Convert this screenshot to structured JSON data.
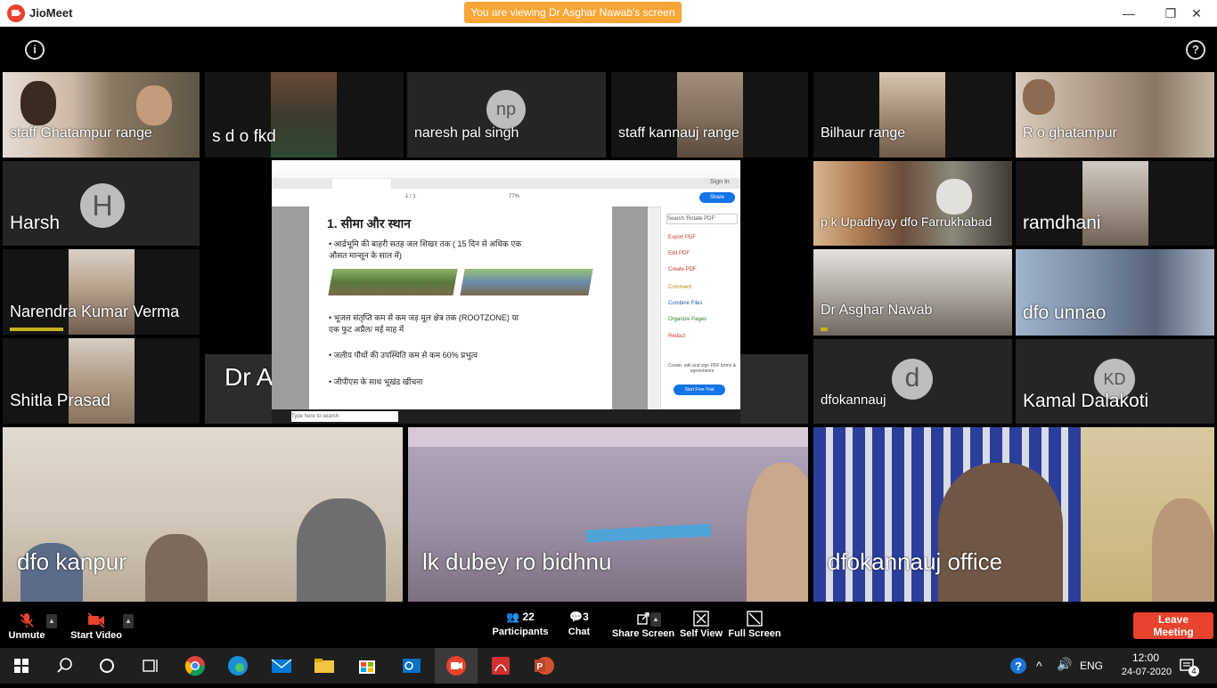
{
  "app": {
    "title": "JioMeet",
    "banner": "You are viewing Dr Asghar Nawab's screen",
    "window_controls": [
      "—",
      "❐",
      "✕"
    ]
  },
  "top_icons": {
    "info": "i",
    "help": "?"
  },
  "participants": {
    "staff_ghatampur": "staff Ghatampur range",
    "sdo_fkd": "s d o fkd",
    "naresh": "naresh pal singh",
    "naresh_initials": "np",
    "staff_kannauj": "staff kannauj range",
    "bilhaur": "Bilhaur range",
    "ro_ghatampur": "R o ghatampur",
    "harsh": "Harsh",
    "harsh_initials": "H",
    "pk_upadhyay": "p k Upadhyay dfo Farrukhabad",
    "ramdhani": "ramdhani",
    "narendra": "Narendra Kumar Verma",
    "asghar_tile": "Dr Asghar Nawab",
    "dfo_unnao": "dfo unnao",
    "shitla": "Shitla Prasad",
    "presenter": "Dr Asghar Nawab",
    "dfokannauj": "dfokannauj",
    "dfokannauj_initials": "d",
    "kamal": "Kamal Dalakoti",
    "kamal_initials": "KD",
    "dfo_kanpur": "dfo kanpur",
    "lk_dubey": "lk dubey ro bidhnu",
    "dfokannauj_office": "dfokannauj office"
  },
  "shared_screen": {
    "heading": "1.   सीमा और स्थान",
    "bullet1_line1": "•  आर्द्रभूमि की बाहरी सतह जल शिखर तक ( 15 दिन से अधिक एक",
    "bullet1_line2": "    औसत मान्सून के साल में)",
    "bullet2_line1": "•  भूजल संतृप्ति कम से कम जड़ मूल क्षेत्र तक (ROOTZONE) या",
    "bullet2_line2": "    एक फुट अप्रैल/ मई माह में",
    "bullet3": "•  जलीय पौधों की उपस्थिति कम से कम 60% प्रभुत्व",
    "bullet4": "•  जीपीएस के साथ भूखंड खींचना",
    "sign_in": "Sign In",
    "share": "Share",
    "search_pdf": "Search 'Rotate PDF'",
    "menu": [
      "Export PDF",
      "Edit PDF",
      "Create PDF",
      "Comment",
      "Combine Files",
      "Organize Pages",
      "Redact"
    ],
    "promo": "Create, edit and sign PDF forms & agreements",
    "trial": "Start Free Trial",
    "zoom": "77%",
    "page": "1 / 1",
    "inner_search": "Type here to search"
  },
  "controls": {
    "unmute": "Unmute",
    "start_video": "Start Video",
    "participants_count": "22",
    "participants": "Participants",
    "chat_count": "3",
    "chat": "Chat",
    "share_screen": "Share Screen",
    "self_view": "Self View",
    "full_screen": "Full Screen",
    "leave": "Leave Meeting"
  },
  "taskbar": {
    "time": "12:00",
    "date": "24-07-2020",
    "lang": "ENG",
    "notifications": "4"
  },
  "colors": {
    "accent": "#e8432e",
    "banner": "#f7a637",
    "speaking": "#c7b21d"
  }
}
